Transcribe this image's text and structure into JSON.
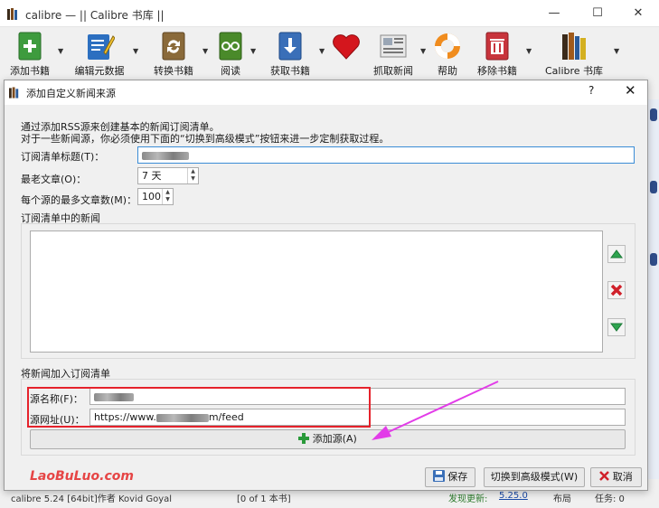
{
  "window": {
    "title": "calibre — || Calibre 书库 ||",
    "minimize": "—",
    "maximize": "☐",
    "close": "✕"
  },
  "toolbar": {
    "items": [
      {
        "label": "添加书籍",
        "icon": "add-book-icon"
      },
      {
        "label": "编辑元数据",
        "icon": "edit-metadata-icon"
      },
      {
        "label": "转换书籍",
        "icon": "convert-book-icon"
      },
      {
        "label": "阅读",
        "icon": "read-book-icon"
      },
      {
        "label": "获取书籍",
        "icon": "get-books-icon"
      },
      {
        "label": "",
        "icon": "heart-icon"
      },
      {
        "label": "抓取新闻",
        "icon": "fetch-news-icon"
      },
      {
        "label": "帮助",
        "icon": "help-lifebuoy-icon"
      },
      {
        "label": "移除书籍",
        "icon": "remove-book-icon"
      },
      {
        "label": "Calibre 书库",
        "icon": "library-icon"
      }
    ],
    "dropdown_arrow": "▼"
  },
  "statusbar": {
    "left": "calibre 5.24 [64bit]作者 Kovid Goyal",
    "count": "[0 of 1 本书]",
    "update": "发现更新:",
    "update_version": "5.25.0",
    "layout": "布局",
    "jobs": "任务: 0"
  },
  "dialog": {
    "title": "添加自定义新闻来源",
    "help": "?",
    "close": "✕",
    "intro_line1": "通过添加RSS源来创建基本的新闻订阅清单。",
    "intro_line2": "对于一些新闻源，你必须使用下面的“切换到高级模式”按钮来进一步定制获取过程。",
    "recipe_title_label": "订阅清单标题(T)：",
    "recipe_title_value": "",
    "oldest_label": "最老文章(O)：",
    "oldest_value": "7 天",
    "max_articles_label": "每个源的最多文章数(M)：",
    "max_articles_value": "100",
    "feeds_group_label": "订阅清单中的新闻",
    "add_group_label": "将新闻加入订阅清单",
    "feed_name_label": "源名称(F)：",
    "feed_name_value": "",
    "feed_url_label": "源网址(U)：",
    "feed_url_prefix": "https://www.",
    "feed_url_suffix": "m/feed",
    "add_feed_button": "添加源(A)",
    "save_button": "保存",
    "advanced_button": "切换到高级模式(W)",
    "cancel_button": "取消",
    "watermark": "LaoBuLuo.com"
  },
  "colors": {
    "highlight_box": "#e5222b",
    "annotation_arrow": "#e23ce8",
    "watermark": "#e64545",
    "focus_border": "#3b8cd6"
  }
}
